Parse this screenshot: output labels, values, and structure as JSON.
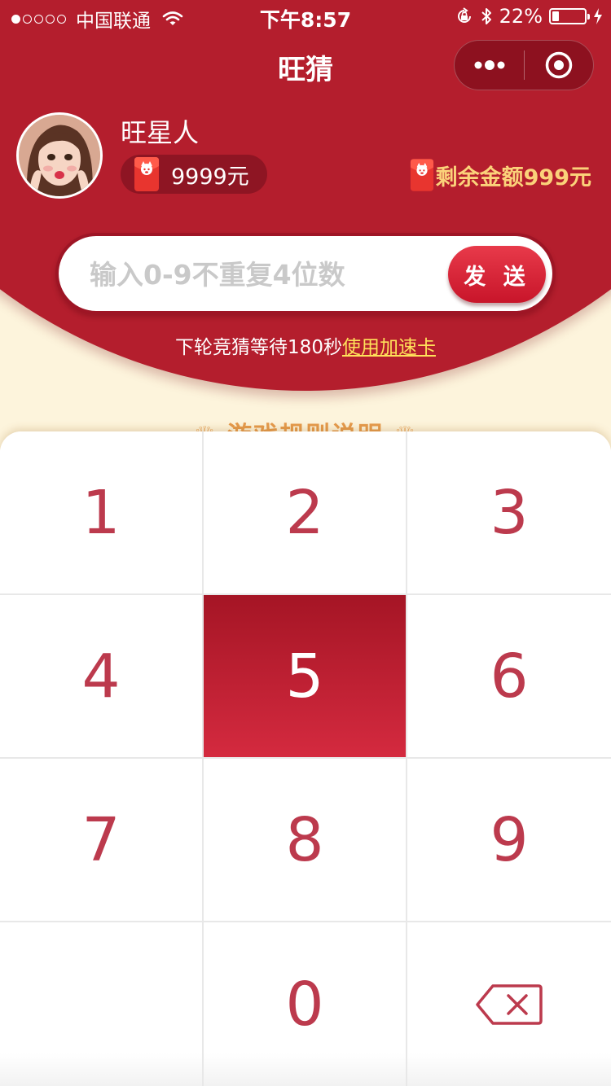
{
  "status_bar": {
    "signal_dots": [
      true,
      false,
      false,
      false,
      false
    ],
    "carrier": "中国联通",
    "time": "下午8:57",
    "battery": "22%",
    "battery_level": 0.22
  },
  "nav": {
    "title": "旺猜"
  },
  "user": {
    "name": "旺星人",
    "balance": "9999元",
    "remaining_label": "剩余金额",
    "remaining_amount": "999元"
  },
  "input": {
    "placeholder": "输入0-9不重复4位数",
    "value": "",
    "send_label": "发 送"
  },
  "wait": {
    "text": "下轮竞猜等待180秒",
    "link": "使用加速卡"
  },
  "rules": {
    "title": "游戏规则说明"
  },
  "keypad": {
    "keys": [
      "1",
      "2",
      "3",
      "4",
      "5",
      "6",
      "7",
      "8",
      "9",
      "",
      "0",
      "⌫"
    ],
    "pressed": "5"
  },
  "colors": {
    "primary_red": "#b41e2d",
    "gold": "#fbd27a",
    "link_yellow": "#ffe15a",
    "key_text": "#bc3a4d",
    "background": "#fdf4dc"
  }
}
